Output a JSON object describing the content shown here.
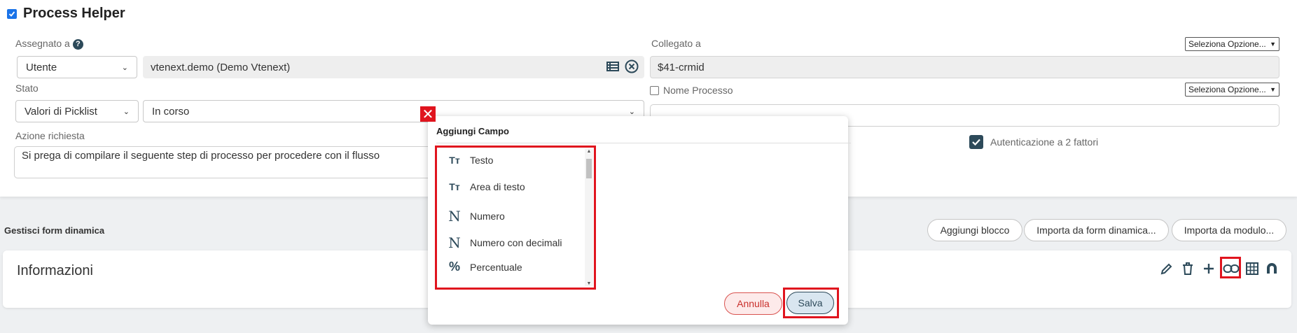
{
  "header": {
    "title": "Process Helper",
    "checked": true
  },
  "assigned": {
    "label": "Assegnato a",
    "help": "?",
    "type_value": "Utente",
    "user_value": "vtenext.demo (Demo Vtenext)"
  },
  "linked": {
    "label": "Collegato a",
    "option_select": "Seleziona Opzione...",
    "value": "$41-crmid"
  },
  "status": {
    "label": "Stato",
    "type_value": "Valori di Picklist",
    "value": "In corso"
  },
  "process_name": {
    "label": "Nome Processo",
    "checked": false,
    "option_select": "Seleziona Opzione...",
    "value": ""
  },
  "action": {
    "label": "Azione richiesta",
    "value": "Si prega di compilare il seguente step di processo per procedere con il flusso"
  },
  "two_factor": {
    "label": "Autenticazione a 2 fattori",
    "checked": true
  },
  "dynamic_form": {
    "label": "Gestisci form dinamica",
    "buttons": [
      "Aggiungi blocco",
      "Importa da form dinamica...",
      "Importa da modulo..."
    ]
  },
  "block": {
    "title": "Informazioni",
    "tools": [
      "pencil-icon",
      "trash-icon",
      "plus-icon",
      "link-icon",
      "table-icon",
      "magnet-icon"
    ]
  },
  "modal": {
    "title": "Aggiungi Campo",
    "fields": [
      {
        "label": "Testo",
        "icon": "Tт"
      },
      {
        "label": "Area di testo",
        "icon": "Tт"
      },
      {
        "label": "Numero",
        "icon": "N"
      },
      {
        "label": "Numero con decimali",
        "icon": "N"
      },
      {
        "label": "Percentuale",
        "icon": "%"
      }
    ],
    "cancel_label": "Annulla",
    "save_label": "Salva",
    "close_label": "✕"
  },
  "colors": {
    "accent": "#2d4a5a",
    "highlight": "#e0141e",
    "checkbox": "#1a73e8"
  }
}
